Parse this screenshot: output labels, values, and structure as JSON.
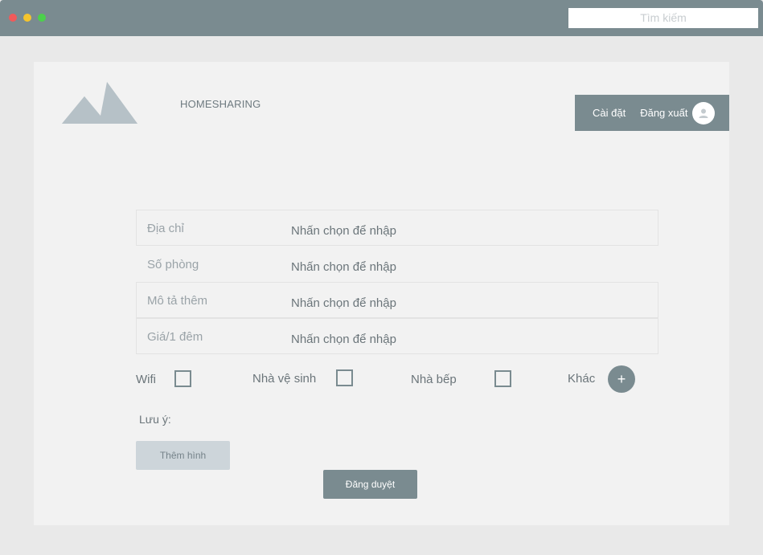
{
  "window": {
    "search_placeholder": "Tìm kiếm"
  },
  "header": {
    "brand": "HOMESHARING",
    "nav": {
      "settings": "Cài đặt",
      "logout": "Đăng xuất"
    }
  },
  "form": {
    "fields": [
      {
        "label": "Địa chỉ",
        "value": "Nhấn chọn để nhập"
      },
      {
        "label": "Số phòng",
        "value": "Nhấn chọn để nhập"
      },
      {
        "label": "Mô tả thêm",
        "value": "Nhấn chọn để nhập"
      },
      {
        "label": "Giá/1 đêm",
        "value": "Nhấn chọn để nhập"
      }
    ],
    "amenities": {
      "wifi": "Wifi",
      "bathroom": "Nhà vệ sinh",
      "kitchen": "Nhà bếp",
      "other": "Khác",
      "add_symbol": "+"
    },
    "note_label": "Lưu ý:",
    "add_image_label": "Thêm hình",
    "submit_label": "Đăng duyệt"
  },
  "colors": {
    "accent": "#7a8b90",
    "panel": "#f2f2f2",
    "background": "#e9e9e9",
    "secondary_button": "#cdd5da"
  },
  "icons": {
    "logo": "mountain-logo-icon",
    "avatar": "user-avatar-icon"
  }
}
